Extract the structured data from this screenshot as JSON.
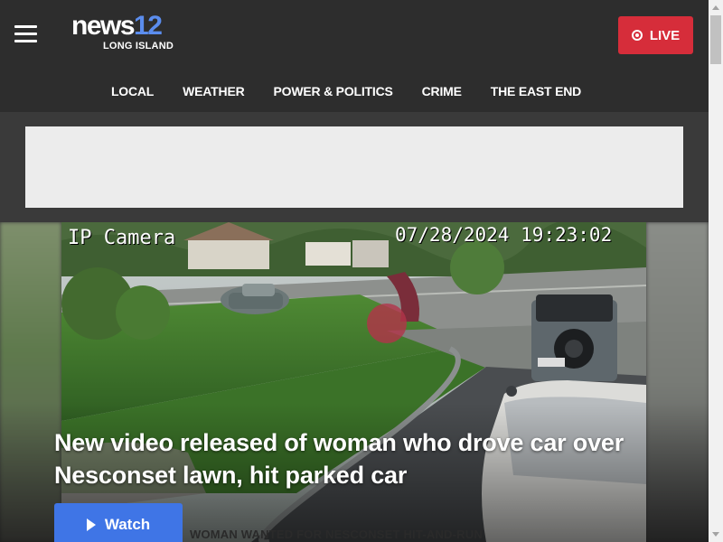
{
  "header": {
    "menu_icon": "hamburger-menu-icon",
    "logo": {
      "main": "news",
      "number": "12",
      "sub": "LONG ISLAND"
    },
    "live_button": {
      "label": "LIVE",
      "icon": "live-record-icon",
      "color": "#d62d3a"
    }
  },
  "nav": {
    "items": [
      {
        "label": "LOCAL"
      },
      {
        "label": "WEATHER"
      },
      {
        "label": "POWER & POLITICS"
      },
      {
        "label": "CRIME"
      },
      {
        "label": "THE EAST END"
      }
    ]
  },
  "hero": {
    "camera_label": "IP Camera",
    "camera_timestamp": "07/28/2024 19:23:02",
    "headline": "New video released of woman who drove car over Nesconset lawn, hit parked car",
    "watch_button": {
      "label": "Watch",
      "icon": "play-icon",
      "color": "#3f75e6"
    },
    "lower_third": "WOMAN WANTED FOR NESCONSET HIT-AND-RUN"
  },
  "colors": {
    "brand_blue": "#5b8dee",
    "header_bg": "#2d2d2d"
  }
}
